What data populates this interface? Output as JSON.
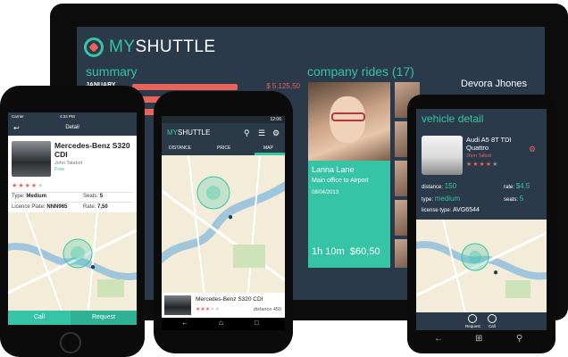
{
  "tablet": {
    "logo_my": "MY",
    "logo_shuttle": "SHUTTLE",
    "summary": {
      "title": "summary",
      "month": "JANUARY",
      "amount": "$ 5.125,50"
    },
    "rides": {
      "title": "company rides (17)",
      "driver_name": "Devora Jhones",
      "featured": {
        "name": "Lanna Lane",
        "route": "Main office to Airport",
        "date": "08/04/2013",
        "duration": "1h 10m",
        "cost": "$60,50"
      }
    }
  },
  "ios_phone": {
    "status": {
      "carrier": "Carrier",
      "time": "4:34 PM"
    },
    "nav_title": "Detail",
    "car": {
      "name": "Mercedes-Benz S320 CDI",
      "driver": "John Talabot",
      "availability": "Free"
    },
    "type_label": "Type:",
    "type_value": "Medium",
    "seats_label": "Seats:",
    "seats_value": "5",
    "licence_label": "Licence Plate:",
    "licence_value": "NNN965",
    "rate_label": "Rate:",
    "rate_value": "7,50",
    "buttons": {
      "call": "Call",
      "request": "Request"
    },
    "rating": 4,
    "rating_max": 5
  },
  "android_phone": {
    "status_time": "12:06",
    "logo_my": "MY",
    "logo_shuttle": "SHUTTLE",
    "tabs": [
      "DISTANCE",
      "PRICE",
      "MAP"
    ],
    "active_tab": "MAP",
    "card": {
      "name": "Mercedes-Benz S320 CDI",
      "distance_label": "distance",
      "distance_value": "450"
    },
    "rating": 3,
    "rating_max": 5
  },
  "windows_phone": {
    "title": "vehicle detail",
    "car": {
      "name": "Audi A5 8T TDI Quattro",
      "driver": "Jhon Talbot"
    },
    "distance_label": "distance:",
    "distance_value": "150",
    "rate_label": "rate:",
    "rate_value": "$4.5",
    "type_label": "type:",
    "type_value": "medium",
    "seats_label": "seats:",
    "seats_value": "5",
    "license_label": "license type:",
    "license_value": "AVG6544",
    "appbar": {
      "request": "Request",
      "call": "Call"
    },
    "rating": 4,
    "rating_max": 5
  },
  "colors": {
    "accent": "#35c4a6",
    "coral": "#e8645a",
    "navy": "#2a3a4a",
    "map": "#f2ecd8"
  }
}
